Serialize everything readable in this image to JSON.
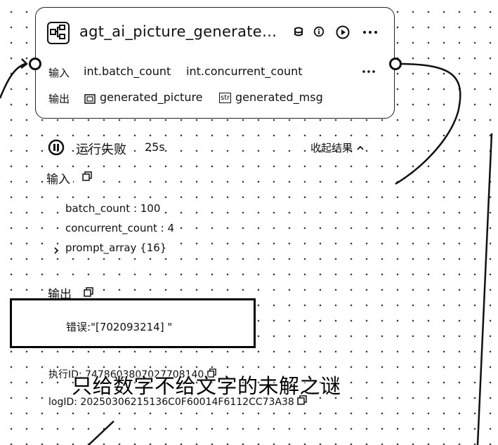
{
  "node": {
    "title": "agt_ai_picture_generate…",
    "icons": [
      "workflow-icon",
      "database-icon",
      "info-icon",
      "play-icon",
      "more-icon"
    ],
    "input_label": "输入",
    "input_params": [
      "int.batch_count",
      "int.concurrent_count"
    ],
    "output_label": "输出",
    "output_params": [
      {
        "type_icon": "image-type-icon",
        "name": "generated_picture"
      },
      {
        "type_icon": "str",
        "name": "generated_msg"
      }
    ]
  },
  "result": {
    "status": "运行失败",
    "duration": "25s",
    "collapse_label": "收起结果",
    "input_title": "输入",
    "inputs": [
      {
        "key": "batch_count",
        "value": "100"
      },
      {
        "key": "concurrent_count",
        "value": "4"
      },
      {
        "key": "prompt_array",
        "value": "{16}"
      }
    ],
    "output_title": "输出",
    "error_label": "错误:",
    "error_value": "\"[702093214] \"",
    "exec_id_label": "执行ID: 7478603807027708140",
    "log_id": "logID: 20250306215136C0F60014F6112CC73A38"
  },
  "caption": "只给数字不给文字的未解之谜",
  "colors": {
    "line": "#111111",
    "background": "#ffffff"
  }
}
